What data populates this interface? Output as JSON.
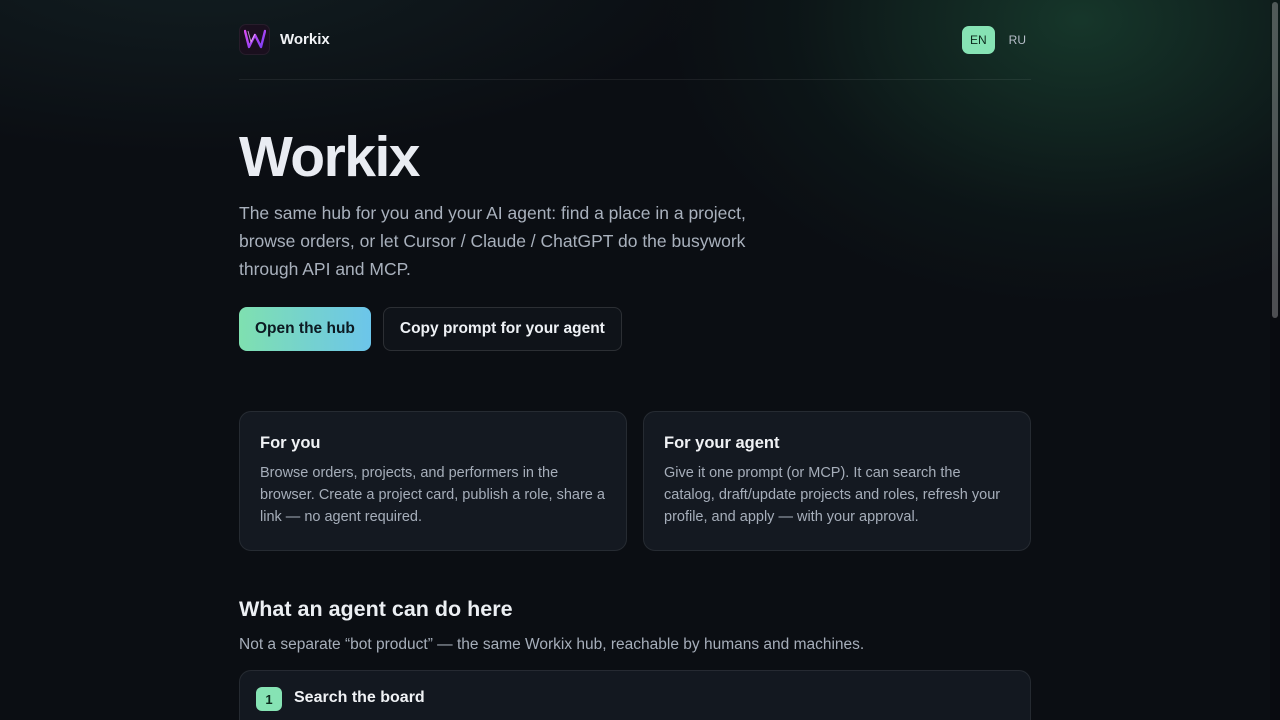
{
  "header": {
    "brand_name": "Workix",
    "logo_letter": "W",
    "languages": [
      {
        "label": "EN",
        "active": true
      },
      {
        "label": "RU",
        "active": false
      }
    ]
  },
  "hero": {
    "title": "Workix",
    "subtitle": "The same hub for you and your AI agent: find a place in a project, browse orders, or let Cursor / Claude / ChatGPT do the busywork through API and MCP.",
    "primary_button": "Open the hub",
    "secondary_button": "Copy prompt for your agent"
  },
  "cards": [
    {
      "title": "For you",
      "body": "Browse orders, projects, and performers in the browser. Create a project card, publish a role, share a link — no agent required."
    },
    {
      "title": "For your agent",
      "body": "Give it one prompt (or MCP). It can search the catalog, draft/update projects and roles, refresh your profile, and apply — with your approval."
    }
  ],
  "agent_section": {
    "title": "What an agent can do here",
    "subtitle": "Not a separate “bot product” — the same Workix hub, reachable by humans and machines.",
    "steps": [
      {
        "number": "1",
        "title": "Search the board"
      }
    ]
  },
  "colors": {
    "accent_green": "#86e3b4",
    "accent_blue": "#6cc5ea",
    "background": "#0b0e13",
    "logo_gradient_start": "#c13bf0",
    "logo_gradient_end": "#6a3cf5"
  }
}
